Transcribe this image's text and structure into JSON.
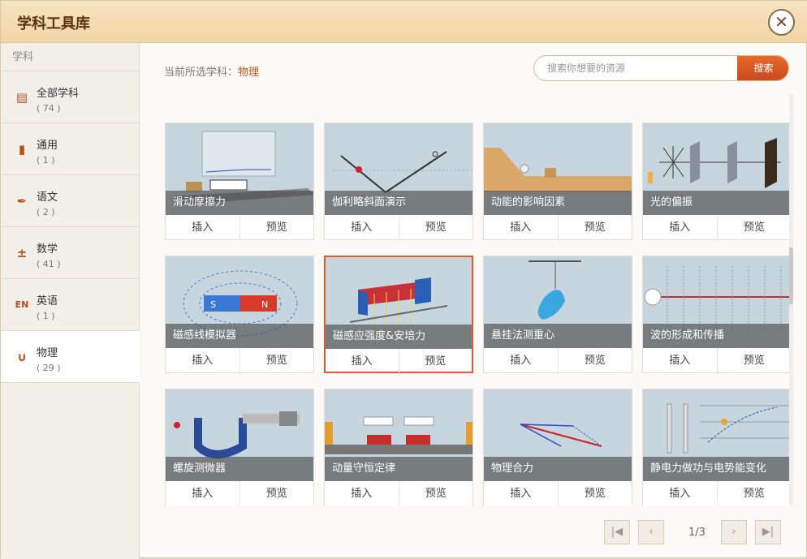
{
  "window": {
    "title": "学科工具库",
    "close_glyph": "✕"
  },
  "sidebar": {
    "header": "学科",
    "items": [
      {
        "label": "全部学科",
        "count": "( 74 )",
        "icon": "grid-icon"
      },
      {
        "label": "通用",
        "count": "( 1 )",
        "icon": "book-icon"
      },
      {
        "label": "语文",
        "count": "( 2 )",
        "icon": "pen-icon"
      },
      {
        "label": "数学",
        "count": "( 41 )",
        "icon": "math-icon"
      },
      {
        "label": "英语",
        "count": "( 1 )",
        "icon": "english-icon"
      },
      {
        "label": "物理",
        "count": "( 29 )",
        "icon": "magnet-icon",
        "active": true
      }
    ]
  },
  "main": {
    "current_label": "当前所选学科：",
    "current_subject": "物理",
    "search": {
      "placeholder": "搜索你想要的资源",
      "value": "",
      "button_label": "搜索"
    },
    "action_insert": "插入",
    "action_preview": "预览",
    "cards": [
      {
        "title": "滑动摩擦力"
      },
      {
        "title": "伽利略斜面演示"
      },
      {
        "title": "动能的影响因素"
      },
      {
        "title": "光的偏振"
      },
      {
        "title": "磁感线模拟器"
      },
      {
        "title": "磁感应强度&安培力",
        "active": true
      },
      {
        "title": "悬挂法测重心"
      },
      {
        "title": "波的形成和传播"
      },
      {
        "title": "螺旋测微器"
      },
      {
        "title": "动量守恒定律"
      },
      {
        "title": "物理合力"
      },
      {
        "title": "静电力做功与电势能变化"
      }
    ],
    "pagination": {
      "page": "1/3"
    }
  },
  "colors": {
    "accent": "#d9541c",
    "title_bar": "#f3dcb2"
  }
}
